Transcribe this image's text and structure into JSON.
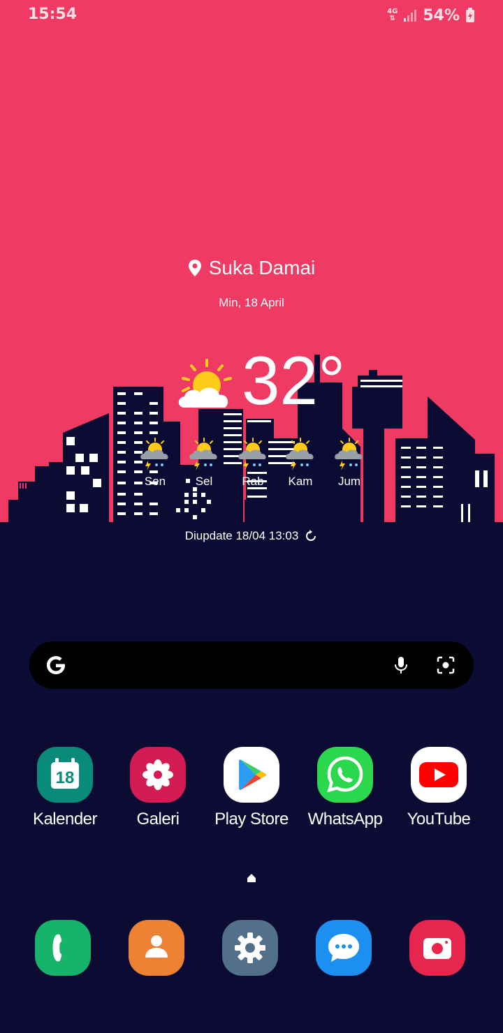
{
  "status_bar": {
    "time": "15:54",
    "network": "4G",
    "battery": "54%"
  },
  "weather": {
    "location": "Suka Damai",
    "date": "Min, 18 April",
    "temperature": "32°",
    "forecast": [
      {
        "day": "Sen"
      },
      {
        "day": "Sel"
      },
      {
        "day": "Rab"
      },
      {
        "day": "Kam"
      },
      {
        "day": "Jum"
      }
    ],
    "updated": "Diupdate 18/04 13:03"
  },
  "apps": [
    {
      "label": "Kalender",
      "icon": "calendar-icon",
      "color": "#0a8a78",
      "badge": "18"
    },
    {
      "label": "Galeri",
      "icon": "gallery-icon",
      "color": "#d31c53"
    },
    {
      "label": "Play Store",
      "icon": "play-store-icon",
      "color": "#ffffff"
    },
    {
      "label": "WhatsApp",
      "icon": "whatsapp-icon",
      "color": "#2bd74c"
    },
    {
      "label": "YouTube",
      "icon": "youtube-icon",
      "color": "#ffffff"
    }
  ],
  "dock": [
    {
      "icon": "phone-icon",
      "color": "#16b36a"
    },
    {
      "icon": "contacts-icon",
      "color": "#ee8234"
    },
    {
      "icon": "settings-icon",
      "color": "#52708a"
    },
    {
      "icon": "messages-icon",
      "color": "#1d8ff0"
    },
    {
      "icon": "camera-icon",
      "color": "#e6264e"
    }
  ],
  "colors": {
    "wallpaper_top": "#ef3a63",
    "wallpaper_bottom": "#0b0b33"
  }
}
